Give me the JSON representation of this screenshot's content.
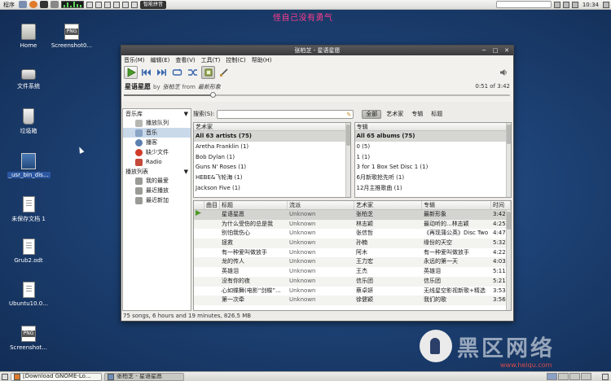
{
  "top_panel": {
    "menu_label": "程序",
    "time": "10:34",
    "input_method": "智能拼音"
  },
  "marquee_text": "怪自己没有勇气",
  "desktop": {
    "icons": [
      {
        "label": "Home",
        "icon": "folder-icon"
      },
      {
        "label": "Screenshot0...",
        "icon": "png-icon"
      },
      {
        "label": "文件系统",
        "icon": "drive-icon"
      },
      {
        "label": "垃圾箱",
        "icon": "trash-icon"
      },
      {
        "label": "_usr_bin_dis...",
        "icon": "link-icon"
      },
      {
        "label": "未保存文档 1",
        "icon": "document-icon"
      },
      {
        "label": "Grub2.odt",
        "icon": "document-icon"
      },
      {
        "label": "Ubuntu10.0...",
        "icon": "document-icon"
      },
      {
        "label": "Screenshot...",
        "icon": "png-icon"
      }
    ]
  },
  "window": {
    "title": "张柏芝 - 星语星愿",
    "menu": [
      "音乐(M)",
      "编辑(E)",
      "查看(V)",
      "工具(T)",
      "控制(C)",
      "帮助(H)"
    ],
    "now_playing": {
      "title": "星语星愿",
      "by": "by",
      "artist": "张柏芝",
      "from": "from",
      "album": "最新形象",
      "time": "0:51 of 3:42",
      "progress": 0.23
    },
    "sidebar": {
      "library_header": "音乐库",
      "library_items": [
        "播放队列",
        "音乐",
        "播客",
        "缺少文件",
        "Radio"
      ],
      "selected": "音乐",
      "playlists_header": "播放列表",
      "playlist_items": [
        "我的最爱",
        "最近播放",
        "最近新加"
      ]
    },
    "search": {
      "label": "搜索(S):",
      "value": "",
      "tabs": [
        "全部",
        "艺术家",
        "专辑",
        "标题"
      ],
      "active_tab": "全部"
    },
    "artist_browser": {
      "header": "艺术家",
      "rows": [
        "All 63 artists (75)",
        "Aretha Franklin (1)",
        "Bob Dylan (1)",
        "Guns N' Roses (1)",
        "HEBE&飞轮海 (1)",
        "Jackson Five (1)"
      ]
    },
    "album_browser": {
      "header": "专辑",
      "rows": [
        "All 65 albums (75)",
        "0 (5)",
        "1 (1)",
        "3 for 1 Box Set Disc 1 (1)",
        "6月新歌抢先听 (1)",
        "12月主推歌曲 (1)"
      ]
    },
    "tracks": {
      "columns": [
        "",
        "曲目",
        "标题",
        "流派",
        "艺术家",
        "专辑",
        "时间"
      ],
      "rows": [
        [
          "",
          "星语星愿",
          "Unknown",
          "张柏芝",
          "最新形象",
          "3:42"
        ],
        [
          "",
          "为什么受伤的总是我",
          "Unknown",
          "林志颖",
          "最动听的...林志颖",
          "4:25"
        ],
        [
          "",
          "别怕我伤心",
          "Unknown",
          "张信哲",
          "《再现蒲公英》Disc Two",
          "4:47"
        ],
        [
          "",
          "拯救",
          "Unknown",
          "孙楠",
          "缘份的天空",
          "5:32"
        ],
        [
          "",
          "有一种爱叫做放手",
          "Unknown",
          "阿木",
          "有一种爱叫做放手",
          "4:22"
        ],
        [
          "",
          "龙的传人",
          "Unknown",
          "王力宏",
          "永远的第一天",
          "4:03"
        ],
        [
          "",
          "英雄泪",
          "Unknown",
          "王杰",
          "英雄泪",
          "5:11"
        ],
        [
          "",
          "没有你的夜",
          "Unknown",
          "信乐团",
          "信乐团",
          "5:21"
        ],
        [
          "",
          "心如蝶舞(电影“剑蝶”...",
          "Unknown",
          "蔡卓妍",
          "无线星空影视新歌+精选",
          "3:53"
        ],
        [
          "",
          "第一次牵",
          "Unknown",
          "徐健颖",
          "我们的歌",
          "3:56"
        ]
      ]
    },
    "status": "75 songs, 6 hours and 19 minutes, 826.5 MB"
  },
  "watermark": {
    "text": "黑区网络",
    "url": "www.heiqu.com"
  },
  "taskbar": {
    "tasks": [
      "[Download GNOME-Lo...",
      "张柏芝 - 星语星愿"
    ],
    "active_task": 1
  }
}
